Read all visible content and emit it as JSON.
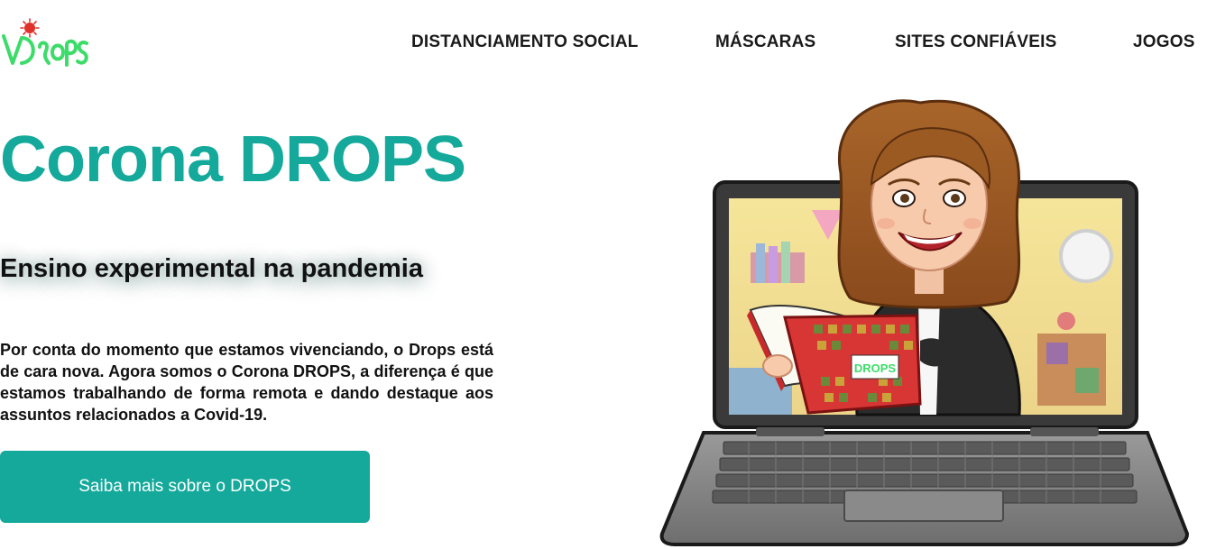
{
  "header": {
    "logo_text": "DROPS",
    "nav": [
      {
        "label": "DISTANCIAMENTO SOCIAL"
      },
      {
        "label": "MÁSCARAS"
      },
      {
        "label": "SITES CONFIÁVEIS"
      },
      {
        "label": "JOGOS"
      }
    ]
  },
  "hero": {
    "title": "Corona DROPS",
    "subtitle": "Ensino experimental na pandemia",
    "paragraph": "Por conta do momento que estamos vivenciando, o Drops está de cara nova. Agora somos o Corona DROPS, a diferença é que estamos trabalhando de forma remota e dando destaque aos assuntos relacionados a Covid-19.",
    "cta_label": "Saiba mais sobre o DROPS"
  },
  "illustration": {
    "book_logo_text": "DROPS"
  },
  "colors": {
    "accent": "#14a99a",
    "logo_green": "#3ddc6a",
    "virus_red": "#e0302a",
    "text": "#111111"
  }
}
